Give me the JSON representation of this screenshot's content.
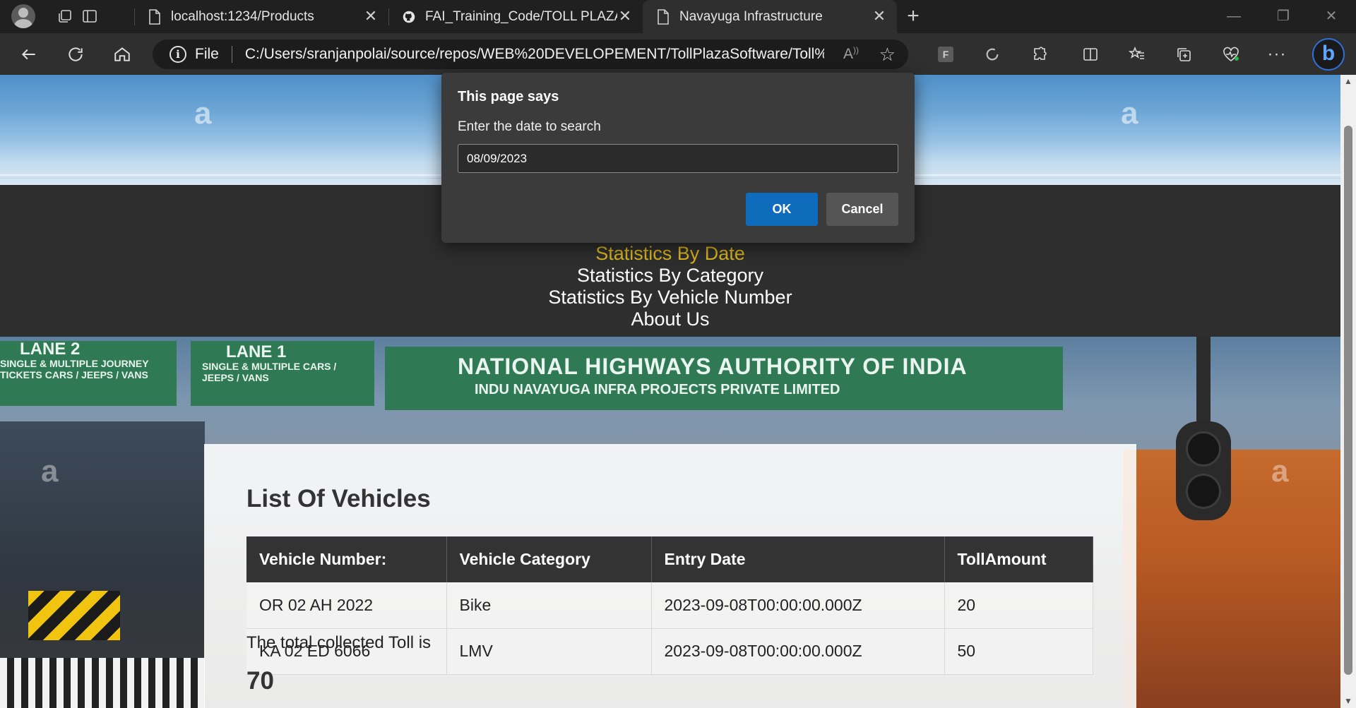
{
  "browser": {
    "tabs": [
      {
        "title": "localhost:1234/Products",
        "active": false,
        "icon": "page-icon"
      },
      {
        "title": "FAI_Training_Code/TOLL PLAZA(W",
        "active": false,
        "icon": "github-icon"
      },
      {
        "title": "Navayuga Infrastructure",
        "active": true,
        "icon": "page-icon"
      }
    ],
    "address": {
      "protocol_label": "File",
      "url": "C:/Users/sranjanpolai/source/repos/WEB%20DEVELOPEMENT/TollPlazaSoftware/Toll%2..."
    }
  },
  "page": {
    "watermark": "a",
    "nav": {
      "items": [
        {
          "label": "Statistics By Date",
          "active": true
        },
        {
          "label": "Statistics By Category",
          "active": false
        },
        {
          "label": "Statistics By Vehicle Number",
          "active": false
        },
        {
          "label": "About Us",
          "active": false
        }
      ],
      "active_color": "#d9b41f"
    },
    "hero": {
      "sign_main": "NATIONAL HIGHWAYS AUTHORITY OF INDIA",
      "sign_sub": "INDU NAVAYUGA INFRA PROJECTS PRIVATE LIMITED",
      "lane2": "LANE 2",
      "lane1": "LANE 1",
      "lane2_sub": "SINGLE & MULTIPLE JOURNEY TICKETS CARS / JEEPS / VANS",
      "lane1_sub": "SINGLE & MULTIPLE CARS / JEEPS / VANS"
    },
    "card": {
      "heading": "List Of Vehicles",
      "columns": [
        "Vehicle Number:",
        "Vehicle Category",
        "Entry Date",
        "TollAmount"
      ],
      "rows": [
        [
          "OR 02 AH 2022",
          "Bike",
          "2023-09-08T00:00:00.000Z",
          "20"
        ],
        [
          "KA 02 ED 6066",
          "LMV",
          "2023-09-08T00:00:00.000Z",
          "50"
        ]
      ],
      "total_label": "The total collected Toll is",
      "total_value": "70"
    }
  },
  "dialog": {
    "title": "This page says",
    "message": "Enter the date to search",
    "input_value": "08/09/2023",
    "ok_label": "OK",
    "cancel_label": "Cancel",
    "ok_color": "#0f6cbd"
  }
}
